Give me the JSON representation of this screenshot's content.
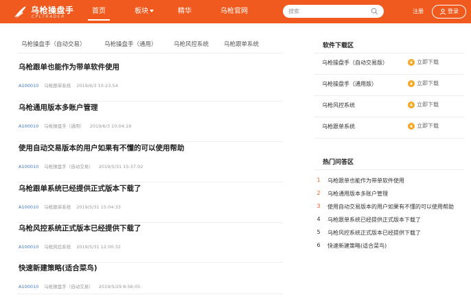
{
  "header": {
    "logo_text": "乌枪操盘手",
    "logo_sub": "CPLTRADER",
    "nav": [
      {
        "label": "首页",
        "active": true
      },
      {
        "label": "板块"
      },
      {
        "label": "精华"
      },
      {
        "label": "乌枪官网"
      }
    ],
    "search_placeholder": "搜索",
    "register_label": "注册",
    "login_label": "登录",
    "brand_color": "#f05a1e"
  },
  "tabs": [
    "乌枪操盘手（自动交易）",
    "乌枪操盘手（通用）",
    "乌枪风控系统",
    "乌枪跟单系统"
  ],
  "articles": [
    {
      "title": "乌枪跟单也能作为带单软件使用",
      "author": "A100010",
      "category": "乌枪跟单系统",
      "time": "2019/6/3 10:23:54"
    },
    {
      "title": "乌枪通用版本多账户管理",
      "author": "A100010",
      "category": "乌枪操盘手（通用）",
      "time": "2019/6/3 10:04:19"
    },
    {
      "title": "使用自动交易版本的用户如果有不懂的可以使用帮助",
      "author": "A100010",
      "category": "乌枪操盘手（自动交易）",
      "time": "2019/5/31 15:37:02"
    },
    {
      "title": "乌枪跟单系统已经提供正式版本下载了",
      "author": "A100010",
      "category": "乌枪跟单系统",
      "time": "2019/5/31 15:04:33"
    },
    {
      "title": "乌枪风控系统正式版本已经提供下载了",
      "author": "A100010",
      "category": "乌枪风控系统",
      "time": "2019/5/31 12:00:32"
    },
    {
      "title": "快速新建策略(适合菜鸟)",
      "author": "A100010",
      "category": "乌枪操盘手（自动交易）",
      "time": "2019/5/29 8:56:05"
    }
  ],
  "sidebar": {
    "download_title": "软件下载区",
    "download_label": "立即下载",
    "downloads": [
      "乌枪操盘手（自动交易版）",
      "乌枪操盘手（通用版）",
      "乌枪风控系统",
      "乌枪跟单系统"
    ],
    "hot_title": "热门问答区",
    "hot": [
      {
        "num": "1",
        "text": "乌枪跟单也能作为带单软件使用"
      },
      {
        "num": "2",
        "text": "乌枪通用版本多账户管理"
      },
      {
        "num": "3",
        "text": "使用自动交易版本的用户如果有不懂的可以使用帮助"
      },
      {
        "num": "4",
        "text": "乌枪跟单系统已经提供正式版本下载了"
      },
      {
        "num": "5",
        "text": "乌枪风控系统正式版本已经提供下载了"
      },
      {
        "num": "6",
        "text": "快速新建策略(适合菜鸟)"
      }
    ]
  }
}
